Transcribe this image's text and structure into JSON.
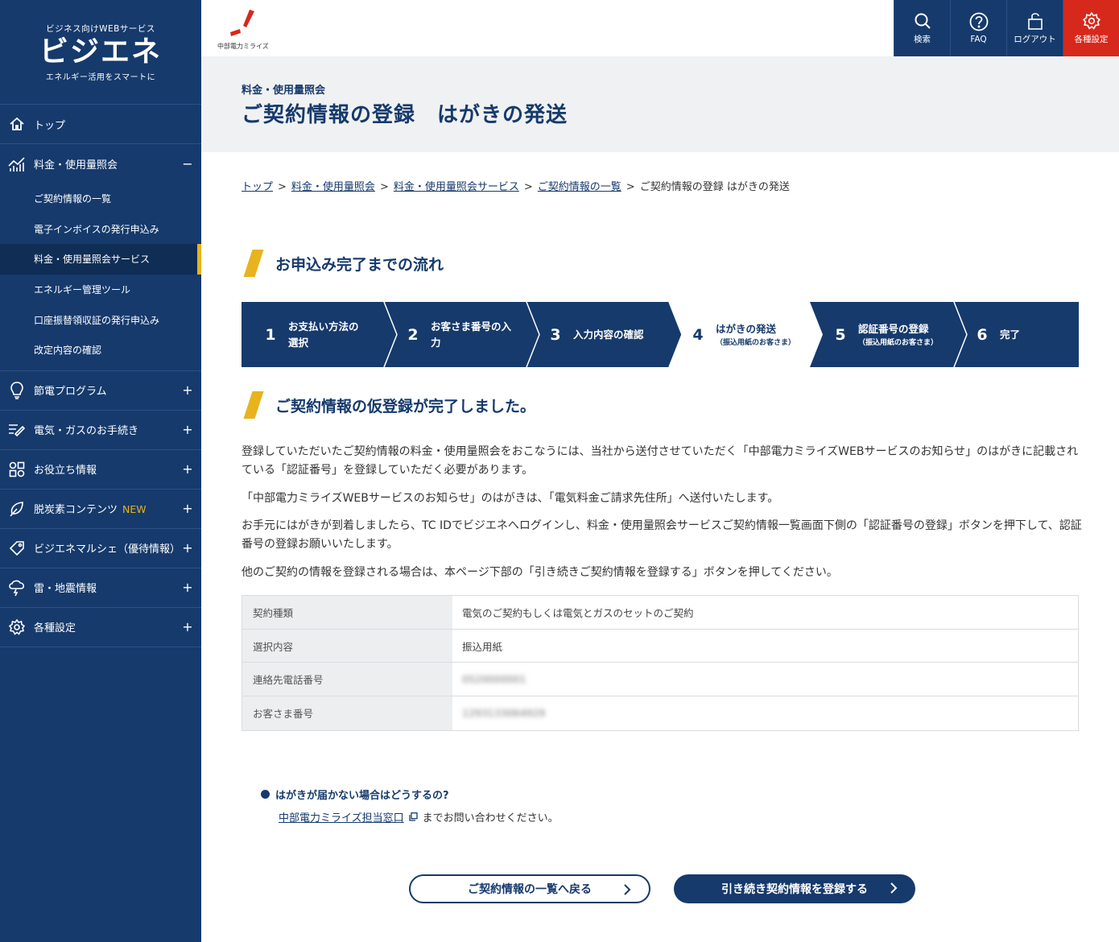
{
  "brand": {
    "tagline": "ビジネス向けWEBサービス",
    "logo": "ビジエネ",
    "subline": "エネルギー活用をスマートに"
  },
  "header": {
    "corp_name": "中部電力ミライズ",
    "tools": [
      {
        "label": "検索",
        "icon": "search-icon"
      },
      {
        "label": "FAQ",
        "icon": "question-icon"
      },
      {
        "label": "ログアウト",
        "icon": "lock-icon"
      },
      {
        "label": "各種設定",
        "icon": "gear-icon"
      }
    ]
  },
  "nav": {
    "top": "トップ",
    "billing": "料金・使用量照会",
    "billing_sub": [
      "ご契約情報の一覧",
      "電子インボイスの発行申込み",
      "料金・使用量照会サービス",
      "エネルギー管理ツール",
      "口座振替領収証の発行申込み",
      "改定内容の確認"
    ],
    "items": [
      {
        "label": "節電プログラム",
        "icon": "bulb-icon"
      },
      {
        "label": "電気・ガスのお手続き",
        "icon": "edit-icon"
      },
      {
        "label": "お役立ち情報",
        "icon": "grid-icon"
      },
      {
        "label": "脱炭素コンテンツ",
        "icon": "leaf-icon",
        "badge": "NEW"
      },
      {
        "label": "ビジエネマルシェ（優待情報）",
        "icon": "tag-icon"
      },
      {
        "label": "雷・地震情報",
        "icon": "storm-icon"
      },
      {
        "label": "各種設定",
        "icon": "gear-icon"
      }
    ]
  },
  "page": {
    "category": "料金・使用量照会",
    "title": "ご契約情報の登録　はがきの発送"
  },
  "breadcrumb": {
    "links": [
      "トップ",
      "料金・使用量照会",
      "料金・使用量照会サービス",
      "ご契約情報の一覧"
    ],
    "current": "ご契約情報の登録 はがきの発送"
  },
  "flow": {
    "heading": "お申込み完了までの流れ",
    "steps": [
      {
        "num": "1",
        "line1": "お支払い方法の",
        "line2": "選択",
        "note": ""
      },
      {
        "num": "2",
        "line1": "お客さま番号の入",
        "line2": "力",
        "note": ""
      },
      {
        "num": "3",
        "line1": "入力内容の確認",
        "line2": "",
        "note": ""
      },
      {
        "num": "4",
        "line1": "はがきの発送",
        "line2": "",
        "note": "（振込用紙のお客さま）"
      },
      {
        "num": "5",
        "line1": "認証番号の登録",
        "line2": "",
        "note": "（振込用紙のお客さま）"
      },
      {
        "num": "6",
        "line1": "完了",
        "line2": "",
        "note": ""
      }
    ]
  },
  "done": {
    "heading": "ご契約情報の仮登録が完了しました。",
    "paragraphs": [
      "登録していただいたご契約情報の料金・使用量照会をおこなうには、当社から送付させていただく「中部電力ミライズWEBサービスのお知らせ」のはがきに記載されている「認証番号」を登録していただく必要があります。",
      "「中部電力ミライズWEBサービスのお知らせ」のはがきは、「電気料金ご請求先住所」へ送付いたします。",
      "お手元にはがきが到着しましたら、TC IDでビジエネへログインし、料金・使用量照会サービスご契約情報一覧画面下側の「認証番号の登録」ボタンを押下して、認証番号の登録お願いいたします。",
      "他のご契約の情報を登録される場合は、本ページ下部の「引き続きご契約情報を登録する」ボタンを押してください。"
    ]
  },
  "info_table": [
    {
      "key": "契約種類",
      "value": "電気のご契約もしくは電気とガスのセットのご契約"
    },
    {
      "key": "選択内容",
      "value": "振込用紙"
    },
    {
      "key": "連絡先電話番号",
      "value": "0520000001"
    },
    {
      "key": "お客さま番号",
      "value": "1293133064929"
    }
  ],
  "faq": {
    "question": "はがきが届かない場合はどうするの?",
    "link": "中部電力ミライズ担当窓口",
    "suffix": "までお問い合わせください。"
  },
  "buttons": {
    "back": "ご契約情報の一覧へ戻る",
    "continue": "引き続き契約情報を登録する"
  }
}
